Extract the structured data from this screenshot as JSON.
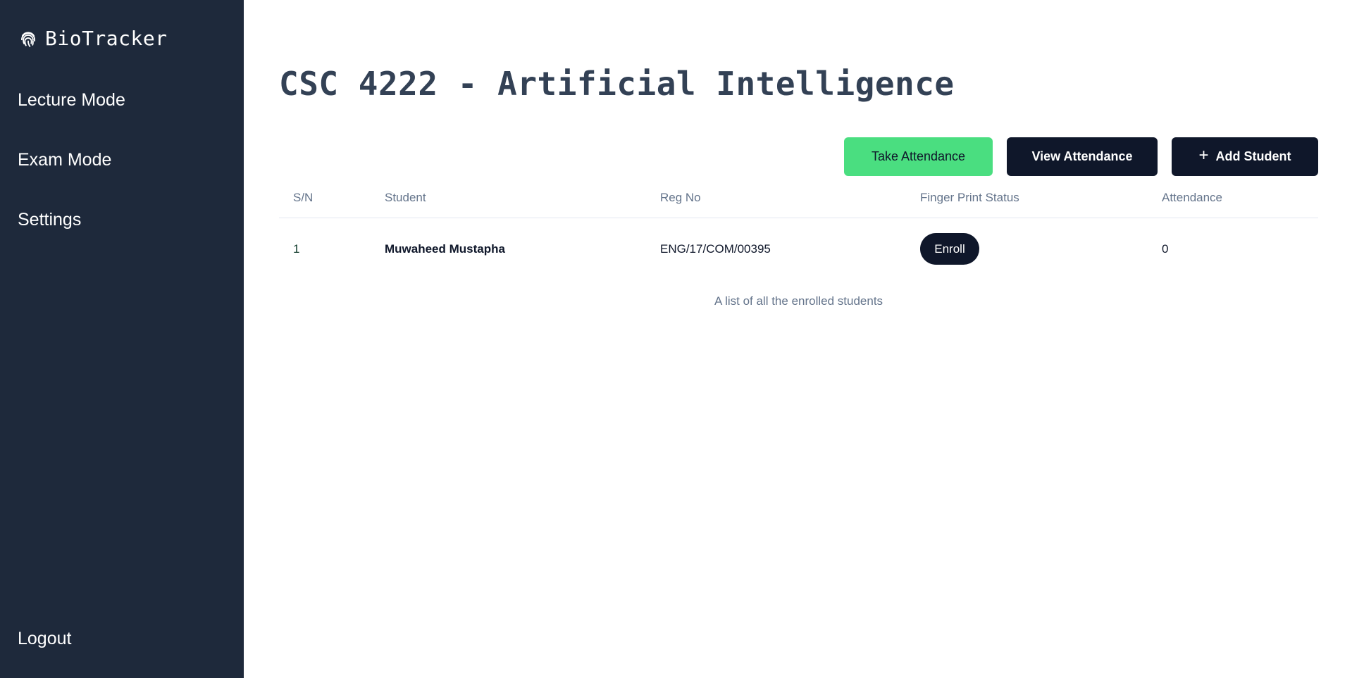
{
  "sidebar": {
    "brand": {
      "name": "BioTracker",
      "icon": "fingerprint-icon"
    },
    "items": [
      {
        "label": "Lecture Mode"
      },
      {
        "label": "Exam Mode"
      },
      {
        "label": "Settings"
      }
    ],
    "logout_label": "Logout"
  },
  "main": {
    "title": "CSC 4222 - Artificial Intelligence",
    "actions": {
      "take_attendance": "Take Attendance",
      "view_attendance": "View Attendance",
      "add_student_icon": "+",
      "add_student": "Add Student"
    },
    "table": {
      "headers": {
        "sn": "S/N",
        "student": "Student",
        "reg_no": "Reg No",
        "fingerprint": "Finger Print Status",
        "attendance": "Attendance"
      },
      "rows": [
        {
          "sn": "1",
          "student": "Muwaheed Mustapha",
          "reg_no": "ENG/17/COM/00395",
          "fingerprint_action": "Enroll",
          "attendance": "0"
        }
      ],
      "caption": "A list of all the enrolled students"
    }
  },
  "colors": {
    "sidebar_bg": "#1e293b",
    "primary_dark": "#0f172a",
    "accent_green": "#4ade80",
    "muted_text": "#64748b",
    "title_text": "#334155"
  }
}
